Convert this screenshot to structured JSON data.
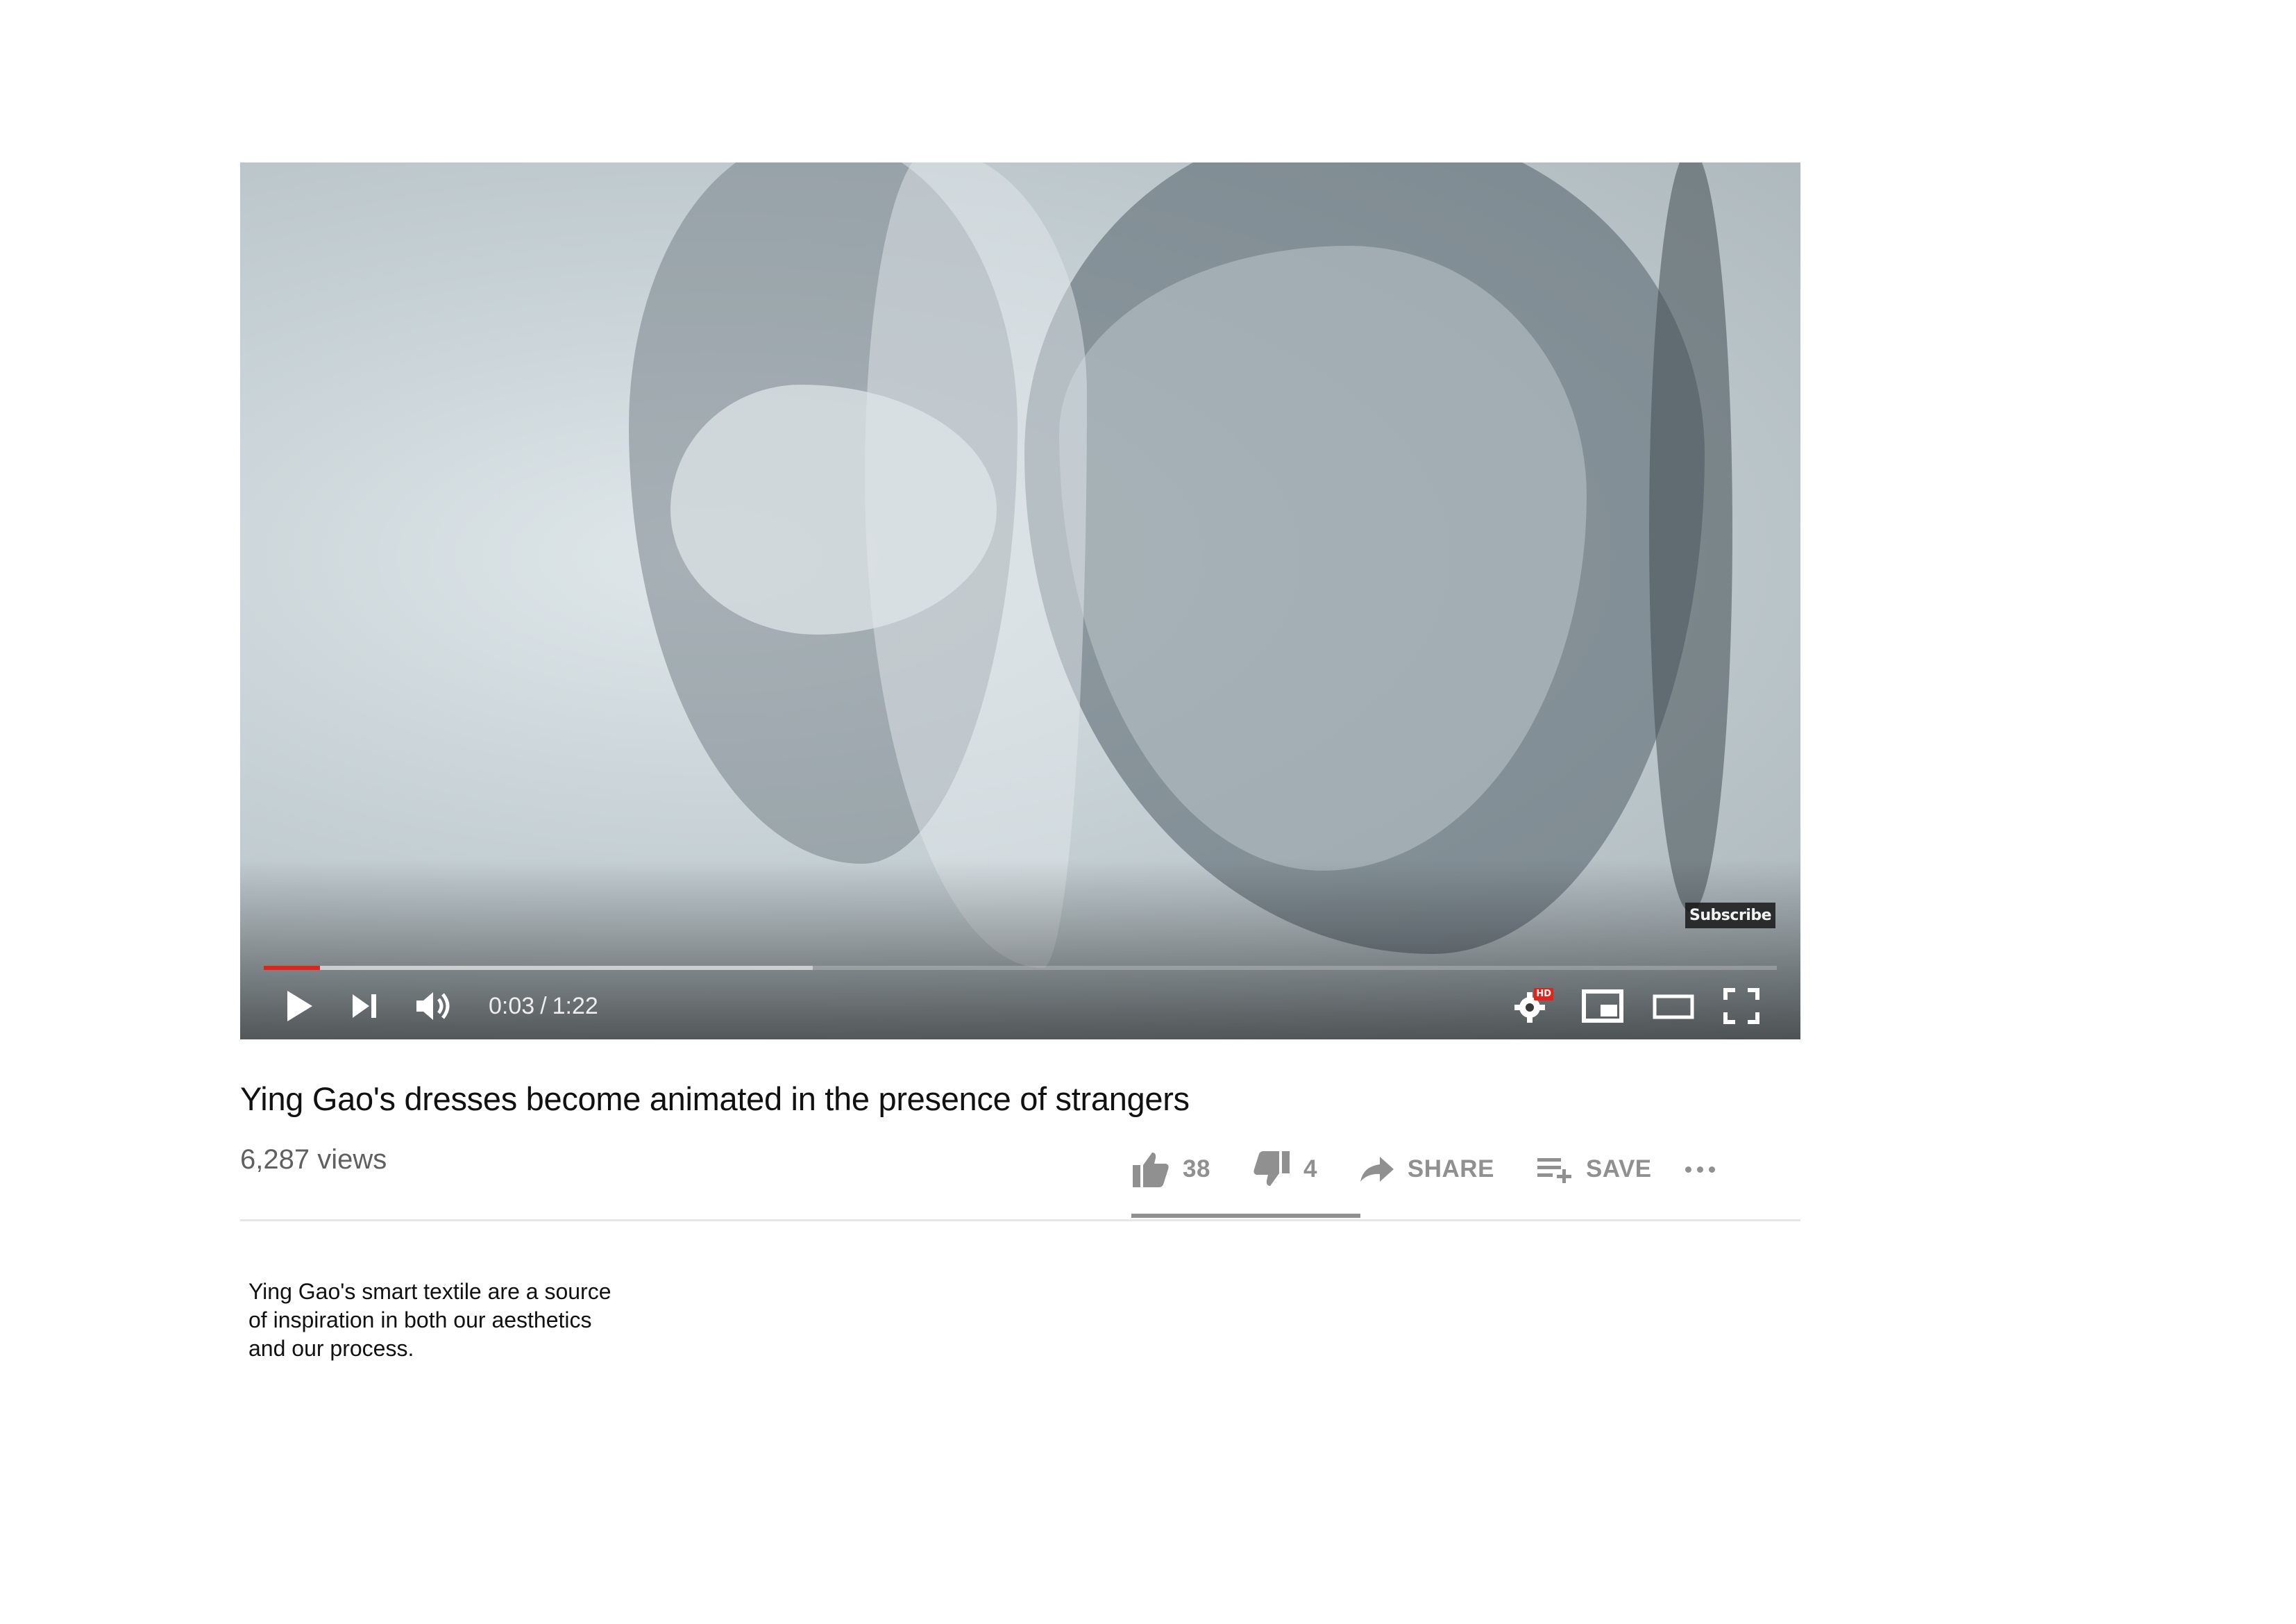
{
  "player": {
    "subscribe_label": "Subscribe",
    "progress": {
      "played_fraction": 0.037,
      "buffered_fraction": 0.363
    },
    "time": {
      "current": "0:03",
      "separator": "/",
      "duration": "1:22"
    },
    "hd_badge": "HD",
    "icons": [
      "play-icon",
      "next-icon",
      "volume-icon",
      "settings-icon",
      "miniplayer-icon",
      "theater-mode-icon",
      "fullscreen-icon"
    ]
  },
  "video": {
    "title": "Ying Gao's dresses become animated in the presence of strangers",
    "views": "6,287 views"
  },
  "actions": {
    "like_count": "38",
    "dislike_count": "4",
    "share_label": "SHARE",
    "save_label": "SAVE",
    "like_ratio": 0.905
  },
  "note": {
    "lines": [
      "Ying Gao's smart textile are a source",
      "of inspiration in both our aesthetics",
      "and our process."
    ]
  },
  "colors": {
    "progress_played": "#e62117",
    "action_gray": "#909090",
    "views_gray": "#606060",
    "title_text": "#111111"
  }
}
